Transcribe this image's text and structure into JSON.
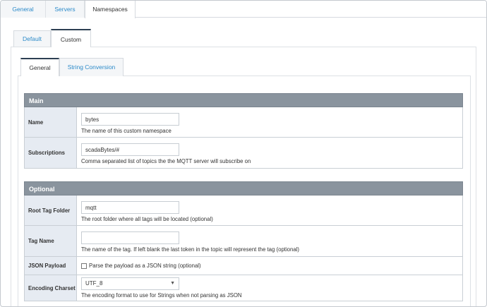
{
  "top_tabs": [
    "General",
    "Servers",
    "Namespaces"
  ],
  "sub_tabs": [
    "Default",
    "Custom"
  ],
  "inner_tabs": [
    "General",
    "String Conversion"
  ],
  "main": {
    "title": "Main",
    "name": {
      "label": "Name",
      "value": "bytes",
      "help": "The name of this custom namespace"
    },
    "subscriptions": {
      "label": "Subscriptions",
      "value": "scadaBytes/#",
      "help": "Comma separated list of topics the the MQTT server will subscribe on"
    }
  },
  "optional": {
    "title": "Optional",
    "root_tag_folder": {
      "label": "Root Tag Folder",
      "value": "mqtt",
      "help": "The root folder where all tags will be located (optional)"
    },
    "tag_name": {
      "label": "Tag Name",
      "value": "",
      "help": "The name of the tag. If left blank the last token in the topic will represent the tag (optional)"
    },
    "json_payload": {
      "label": "JSON Payload",
      "checkbox_label": "Parse the payload as a JSON string (optional)",
      "checked": false
    },
    "encoding_charset": {
      "label": "Encoding Charset",
      "value": "UTF_8",
      "help": "The encoding format to use for Strings when not parsing as JSON"
    }
  },
  "colors": {
    "accent": "#2b8ac9",
    "section_header": "#8a949e",
    "label_bg": "#e6ebf2"
  }
}
